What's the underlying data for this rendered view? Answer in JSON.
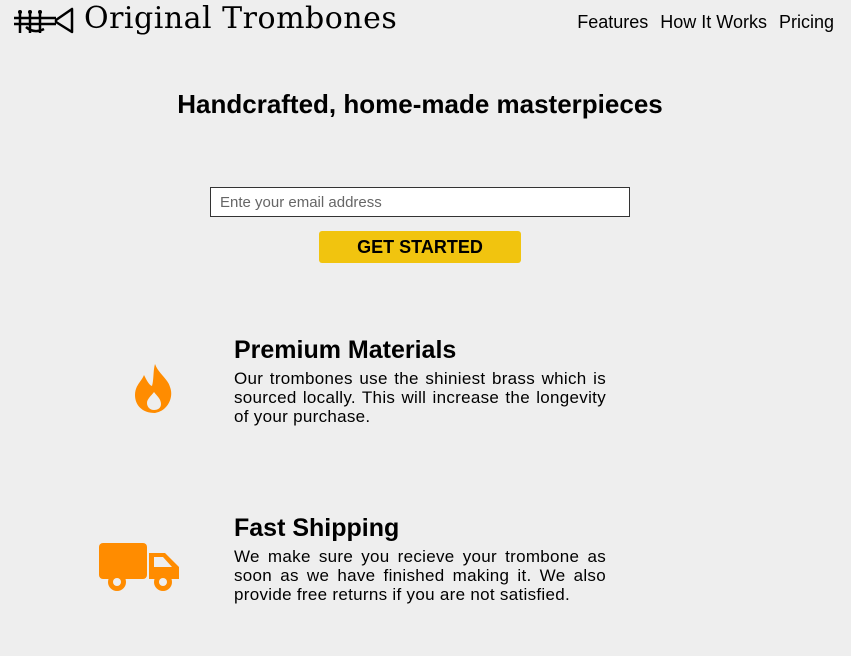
{
  "header": {
    "brand": "Original Trombones",
    "logo_icon": "trombone-icon",
    "nav": [
      {
        "label": "Features"
      },
      {
        "label": "How It Works"
      },
      {
        "label": "Pricing"
      }
    ]
  },
  "hero": {
    "title": "Handcrafted, home-made masterpieces",
    "email_placeholder": "Ente your email address",
    "cta_label": "GET STARTED",
    "cta_color": "#f1c40f"
  },
  "features": [
    {
      "icon": "fire-icon",
      "title": "Premium Materials",
      "description": "Our trombones use the shiniest brass which is sourced locally. This will increase the longevity of your purchase."
    },
    {
      "icon": "truck-icon",
      "title": "Fast Shipping",
      "description": "We make sure you recieve your trombone as soon as we have finished making it. We also provide free returns if you are not satisfied."
    }
  ],
  "colors": {
    "background": "#eeeeee",
    "icon_orange": "#ff8c00"
  }
}
